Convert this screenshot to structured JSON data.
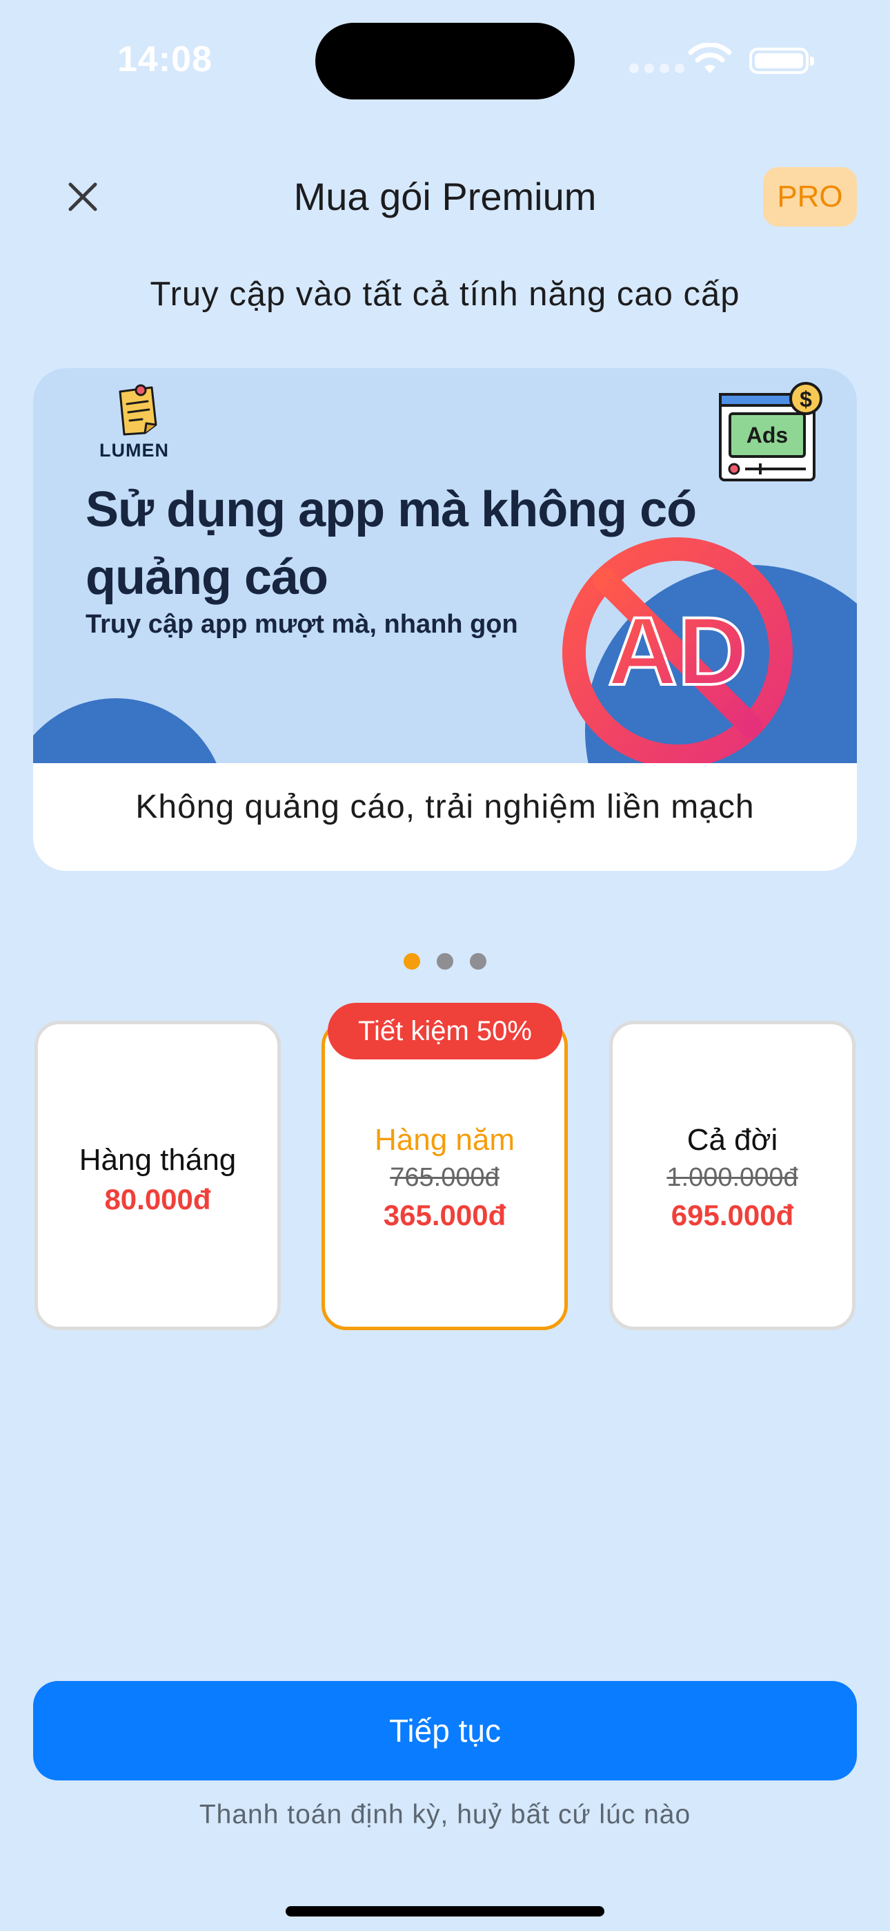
{
  "status_bar": {
    "time": "14:08"
  },
  "header": {
    "title": "Mua gói Premium",
    "pro_badge": "PRO"
  },
  "subtitle": "Truy cập vào tất cả tính năng cao cấp",
  "feature_carousel": {
    "active_index": 0,
    "page_count": 3,
    "current": {
      "brand": "LUMEN",
      "headline": "Sử dụng app mà không có quảng cáo",
      "tagline": "Truy cập app mượt mà, nhanh gọn",
      "ads_label": "Ads",
      "no_ad_label": "AD",
      "caption": "Không quảng cáo, trải nghiệm liền mạch"
    }
  },
  "plans": {
    "monthly": {
      "name": "Hàng tháng",
      "price": "80.000đ"
    },
    "yearly": {
      "name": "Hàng năm",
      "old_price": "765.000đ",
      "price": "365.000đ",
      "badge": "Tiết kiệm 50%",
      "selected": true
    },
    "lifetime": {
      "name": "Cả đời",
      "old_price": "1.000.000đ",
      "price": "695.000đ"
    }
  },
  "cta": {
    "continue_label": "Tiếp tục",
    "note": "Thanh toán định kỳ, huỷ bất cứ lúc nào"
  },
  "colors": {
    "background": "#d6e8fb",
    "accent_orange": "#f59d0a",
    "price_red": "#f0403a",
    "primary_blue": "#0a7cff"
  }
}
